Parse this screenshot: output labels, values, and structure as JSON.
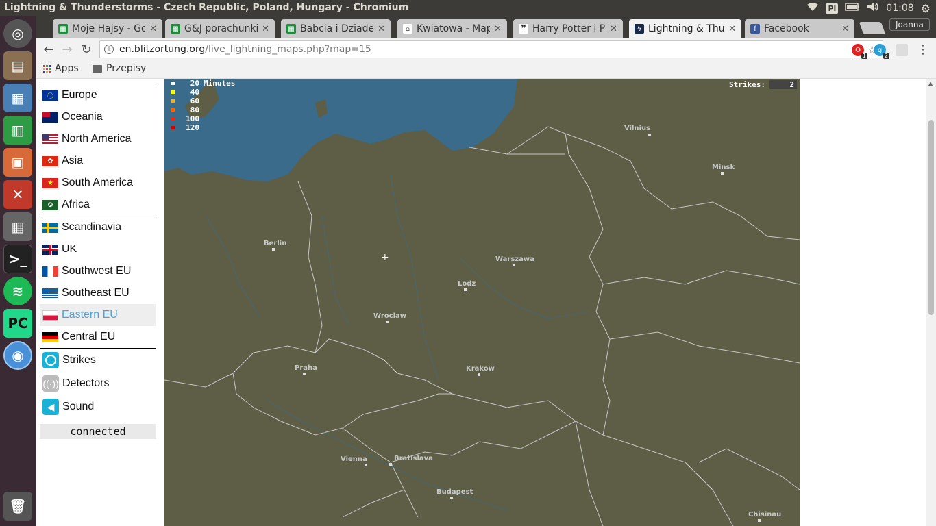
{
  "window": {
    "title": "Lightning & Thunderstorms - Czech Republic, Poland, Hungary - Chromium",
    "keyboard_layout": "Pl",
    "clock": "01:08"
  },
  "launcher": {
    "apps": [
      "ubuntu-dash-icon",
      "files-icon",
      "image-viewer-icon",
      "spreadsheet-icon",
      "presentation-icon",
      "system-settings-icon",
      "calculator-icon",
      "terminal-icon",
      "spotify-icon",
      "pycharm-icon",
      "chromium-icon"
    ],
    "trash": "trash-icon"
  },
  "tabs": [
    {
      "label": "Moje Hajsy - Goo",
      "icon": "sheets-icon",
      "color": "#1e8e3e",
      "active": false
    },
    {
      "label": "G&J porachunki",
      "icon": "sheets-icon",
      "color": "#1e8e3e",
      "active": false
    },
    {
      "label": "Babcia i Dziadek",
      "icon": "sheets-icon",
      "color": "#1e8e3e",
      "active": false
    },
    {
      "label": "Kwiatowa - Map",
      "icon": "pin-icon",
      "color": "#555555",
      "active": false
    },
    {
      "label": "Harry Potter i P",
      "icon": "quote-icon",
      "color": "#222222",
      "active": false
    },
    {
      "label": "Lightning & Thu",
      "icon": "lightning-icon",
      "color": "#1a2a4a",
      "active": true
    },
    {
      "label": "Facebook",
      "icon": "facebook-icon",
      "color": "#3b5998",
      "active": false
    }
  ],
  "profile": "Joanna",
  "omnibox": {
    "host": "en.blitzortung.org",
    "path": "/live_lightning_maps.php?map=15"
  },
  "extensions": [
    {
      "name": "opera-ext-icon",
      "badge": "1",
      "color": "#d22"
    },
    {
      "name": "ghostery-icon",
      "badge": "2",
      "color": "#2a9fd8"
    },
    {
      "name": "extension-icon",
      "badge": "",
      "color": "#ccc"
    }
  ],
  "bookmarks": {
    "apps": "Apps",
    "folder": "Przepisy"
  },
  "menu": {
    "continents": [
      {
        "label": "Europe",
        "flag": "eu"
      },
      {
        "label": "Oceania",
        "flag": "au"
      },
      {
        "label": "North America",
        "flag": "us"
      },
      {
        "label": "Asia",
        "flag": "hk"
      },
      {
        "label": "South America",
        "flag": "vn"
      },
      {
        "label": "Africa",
        "flag": "af"
      }
    ],
    "regions": [
      {
        "label": "Scandinavia",
        "flag": "se"
      },
      {
        "label": "UK",
        "flag": "gb"
      },
      {
        "label": "Southwest EU",
        "flag": "fr"
      },
      {
        "label": "Southeast EU",
        "flag": "gr"
      },
      {
        "label": "Eastern EU",
        "flag": "pl",
        "selected": true
      },
      {
        "label": "Central EU",
        "flag": "de"
      }
    ],
    "tools": [
      {
        "label": "Strikes",
        "icon": "strikes-icon",
        "color": "#19b2d6"
      },
      {
        "label": "Detectors",
        "icon": "detectors-icon",
        "color": "#bbbbbb"
      },
      {
        "label": "Sound",
        "icon": "sound-icon",
        "color": "#19b2d6"
      }
    ],
    "status": "connected"
  },
  "map": {
    "legend": {
      "unit": "Minutes",
      "steps": [
        {
          "value": "20",
          "color": "#ffffff"
        },
        {
          "value": "40",
          "color": "#ffff00"
        },
        {
          "value": "60",
          "color": "#ffaa00"
        },
        {
          "value": "80",
          "color": "#ff6600"
        },
        {
          "value": "100",
          "color": "#ff2200"
        },
        {
          "value": "120",
          "color": "#cc0000"
        }
      ]
    },
    "strikes_label": "Strikes:",
    "strikes_count": "2",
    "cities": [
      "Vilnius",
      "Minsk",
      "Berlin",
      "Warszawa",
      "Lodz",
      "Wroclaw",
      "Praha",
      "Krakow",
      "Vienna",
      "Bratislava",
      "Budapest",
      "Chisinau"
    ],
    "colors": {
      "land": "#5d5e45",
      "sea": "#3a6b8a",
      "border": "#c8c8c8"
    }
  }
}
